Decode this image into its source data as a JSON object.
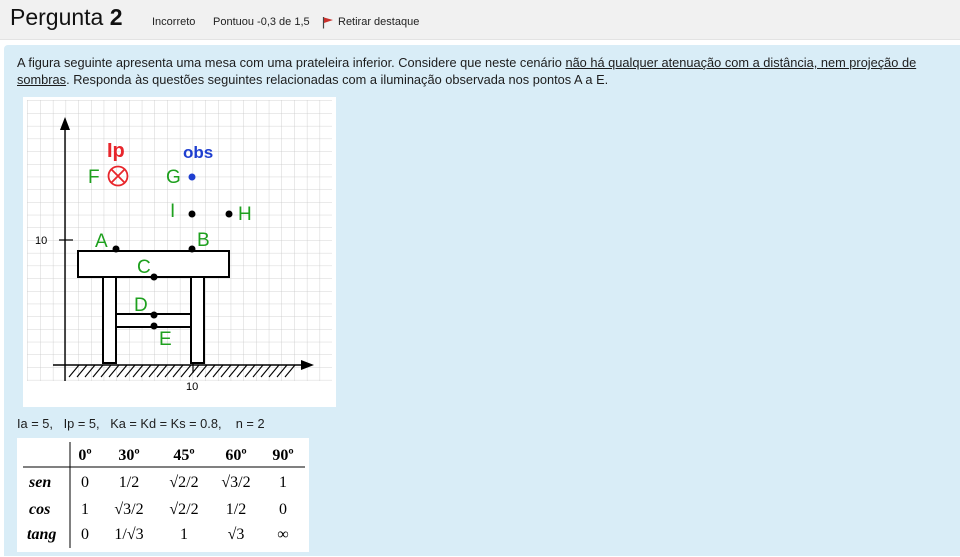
{
  "header": {
    "title_prefix": "Pergunta",
    "number": "2",
    "status": "Incorreto",
    "score": "Pontuou -0,3 de 1,5",
    "flag_label": "Retirar destaque"
  },
  "question": {
    "text_before": "A figura seguinte apresenta uma mesa com uma prateleira inferior. Considere que neste cenário ",
    "text_underlined": "não há qualquer atenuação com  a distância, nem projeção de sombras",
    "text_after": ". Responda às questões seguintes relacionadas com a iluminação observada nos pontos A a E."
  },
  "figure": {
    "labels": {
      "ip": "Ip",
      "obs": "obs",
      "F": "F",
      "G": "G",
      "I": "I",
      "H": "H",
      "A": "A",
      "B": "B",
      "C": "C",
      "D": "D",
      "E": "E",
      "y_tick": "10",
      "x_tick": "10"
    },
    "colors": {
      "red": "#e8262c",
      "blue": "#1f3fd0",
      "green": "#1ea01e",
      "black": "#000000"
    }
  },
  "params": "Ia = 5,   Ip = 5,   Ka = Kd = Ks = 0.8,    n = 2",
  "trig_table": {
    "headers": [
      "0º",
      "30º",
      "45º",
      "60º",
      "90º"
    ],
    "rows": [
      {
        "label": "sen",
        "values": [
          "0",
          "1/2",
          "√2/2",
          "√3/2",
          "1"
        ]
      },
      {
        "label": "cos",
        "values": [
          "1",
          "√3/2",
          "√2/2",
          "1/2",
          "0"
        ]
      },
      {
        "label": "tang",
        "values": [
          "0",
          "1/√3",
          "1",
          "√3",
          "∞"
        ]
      }
    ]
  }
}
